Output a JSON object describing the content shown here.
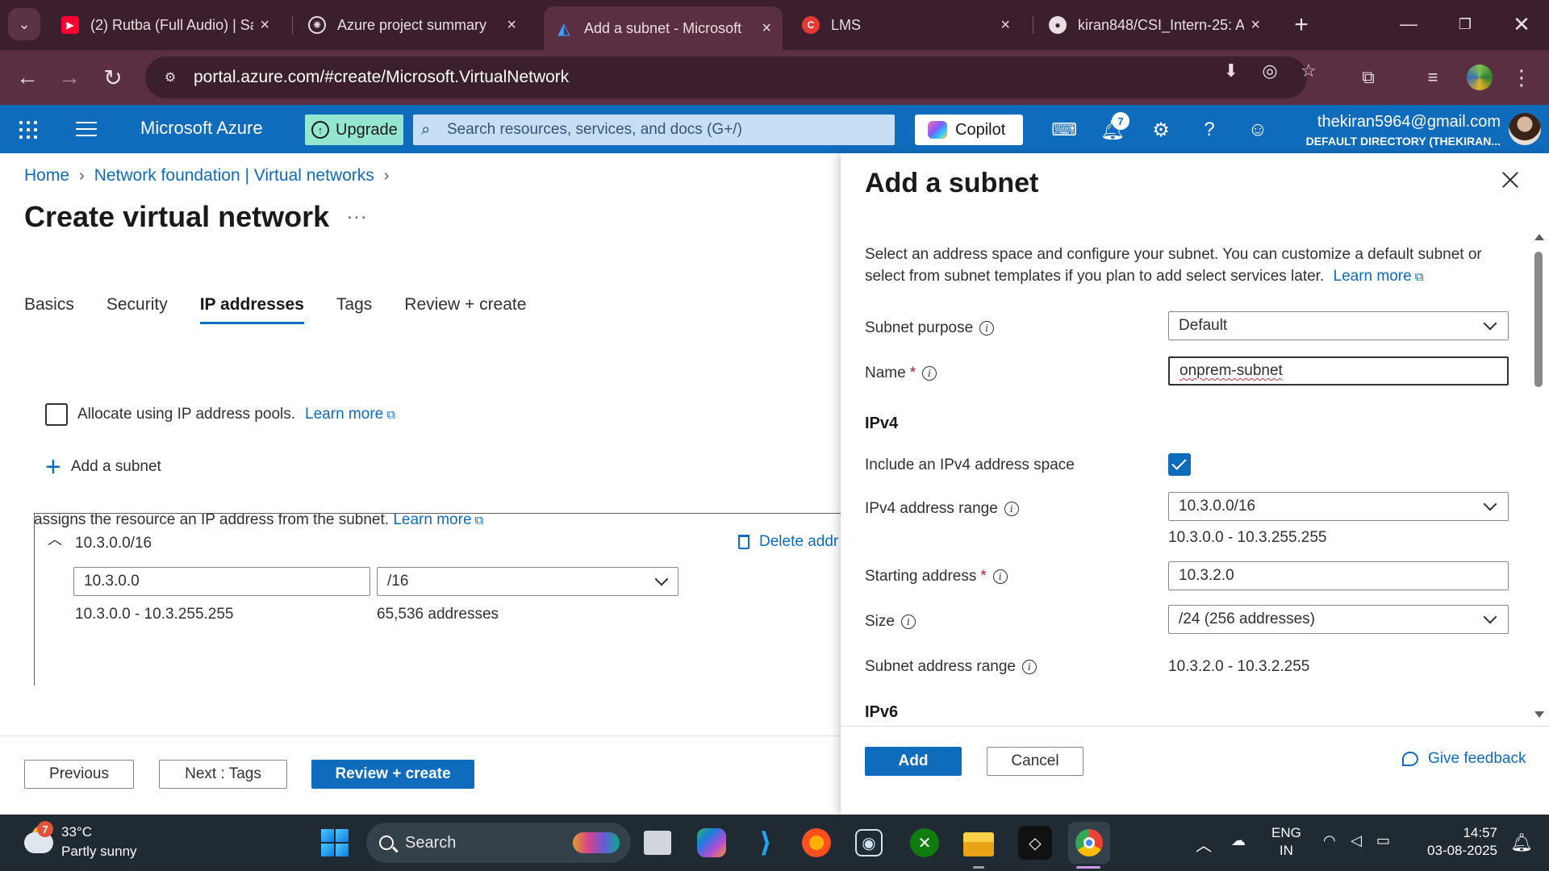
{
  "browser": {
    "tabs": [
      {
        "title": "(2) Rutba (Full Audio) | Sa",
        "favicon": "youtube-icon",
        "active": false
      },
      {
        "title": "Azure project summary",
        "favicon": "chatgpt-icon",
        "active": false
      },
      {
        "title": "Add a subnet - Microsoft",
        "favicon": "azure-icon",
        "active": true
      },
      {
        "title": "LMS",
        "favicon": "lms-icon",
        "active": false
      },
      {
        "title": "kiran848/CSI_Intern-25: A",
        "favicon": "github-icon",
        "active": false
      }
    ],
    "url": "portal.azure.com/#create/Microsoft.VirtualNetwork"
  },
  "azure_header": {
    "brand": "Microsoft Azure",
    "upgrade_label": "Upgrade",
    "search_placeholder": "Search resources, services, and docs (G+/)",
    "copilot_label": "Copilot",
    "notification_count": "7",
    "account_email": "thekiran5964@gmail.com",
    "account_directory": "DEFAULT DIRECTORY (THEKIRAN..."
  },
  "main": {
    "breadcrumb": [
      "Home",
      "Network foundation | Virtual networks"
    ],
    "title": "Create virtual network",
    "more": "...",
    "tabs": [
      "Basics",
      "Security",
      "IP addresses",
      "Tags",
      "Review + create"
    ],
    "selected_tab": "IP addresses",
    "assign_text": "assigns the resource an IP address from the subnet.",
    "learn_more": "Learn more",
    "allocate_label": "Allocate using IP address pools.",
    "add_subnet_label": "Add a subnet",
    "address_space": {
      "title": "10.3.0.0/16",
      "delete_label": "Delete addr",
      "start_address": "10.3.0.0",
      "prefix": "/16",
      "range": "10.3.0.0 - 10.3.255.255",
      "count": "65,536 addresses"
    },
    "buttons": {
      "previous": "Previous",
      "next": "Next : Tags",
      "review": "Review + create"
    }
  },
  "panel": {
    "title": "Add a subnet",
    "description": "Select an address space and configure your subnet. You can customize a default subnet or select from subnet templates if you plan to add select services later.",
    "learn_more": "Learn more",
    "subnet_purpose_label": "Subnet purpose",
    "subnet_purpose_value": "Default",
    "name_label": "Name",
    "name_value": "onprem-subnet",
    "ipv4_heading": "IPv4",
    "include_ipv4_label": "Include an IPv4 address space",
    "include_ipv4_checked": true,
    "ipv4_range_label": "IPv4 address range",
    "ipv4_range_value": "10.3.0.0/16",
    "ipv4_range_span": "10.3.0.0 - 10.3.255.255",
    "starting_address_label": "Starting address",
    "starting_address_value": "10.3.2.0",
    "size_label": "Size",
    "size_value": "/24 (256 addresses)",
    "subnet_range_label": "Subnet address range",
    "subnet_range_value": "10.3.2.0 - 10.3.2.255",
    "ipv6_heading": "IPv6",
    "add_button": "Add",
    "cancel_button": "Cancel",
    "feedback_label": "Give feedback"
  },
  "taskbar": {
    "weather_badge": "7",
    "temperature": "33°C",
    "weather": "Partly sunny",
    "search_label": "Search",
    "lang_top": "ENG",
    "lang_bottom": "IN",
    "time": "14:57",
    "date": "03-08-2025"
  },
  "colors": {
    "azure_blue": "#0f6cbd",
    "browser_frame": "#3c1f2d",
    "taskbar": "#1f2a33"
  }
}
